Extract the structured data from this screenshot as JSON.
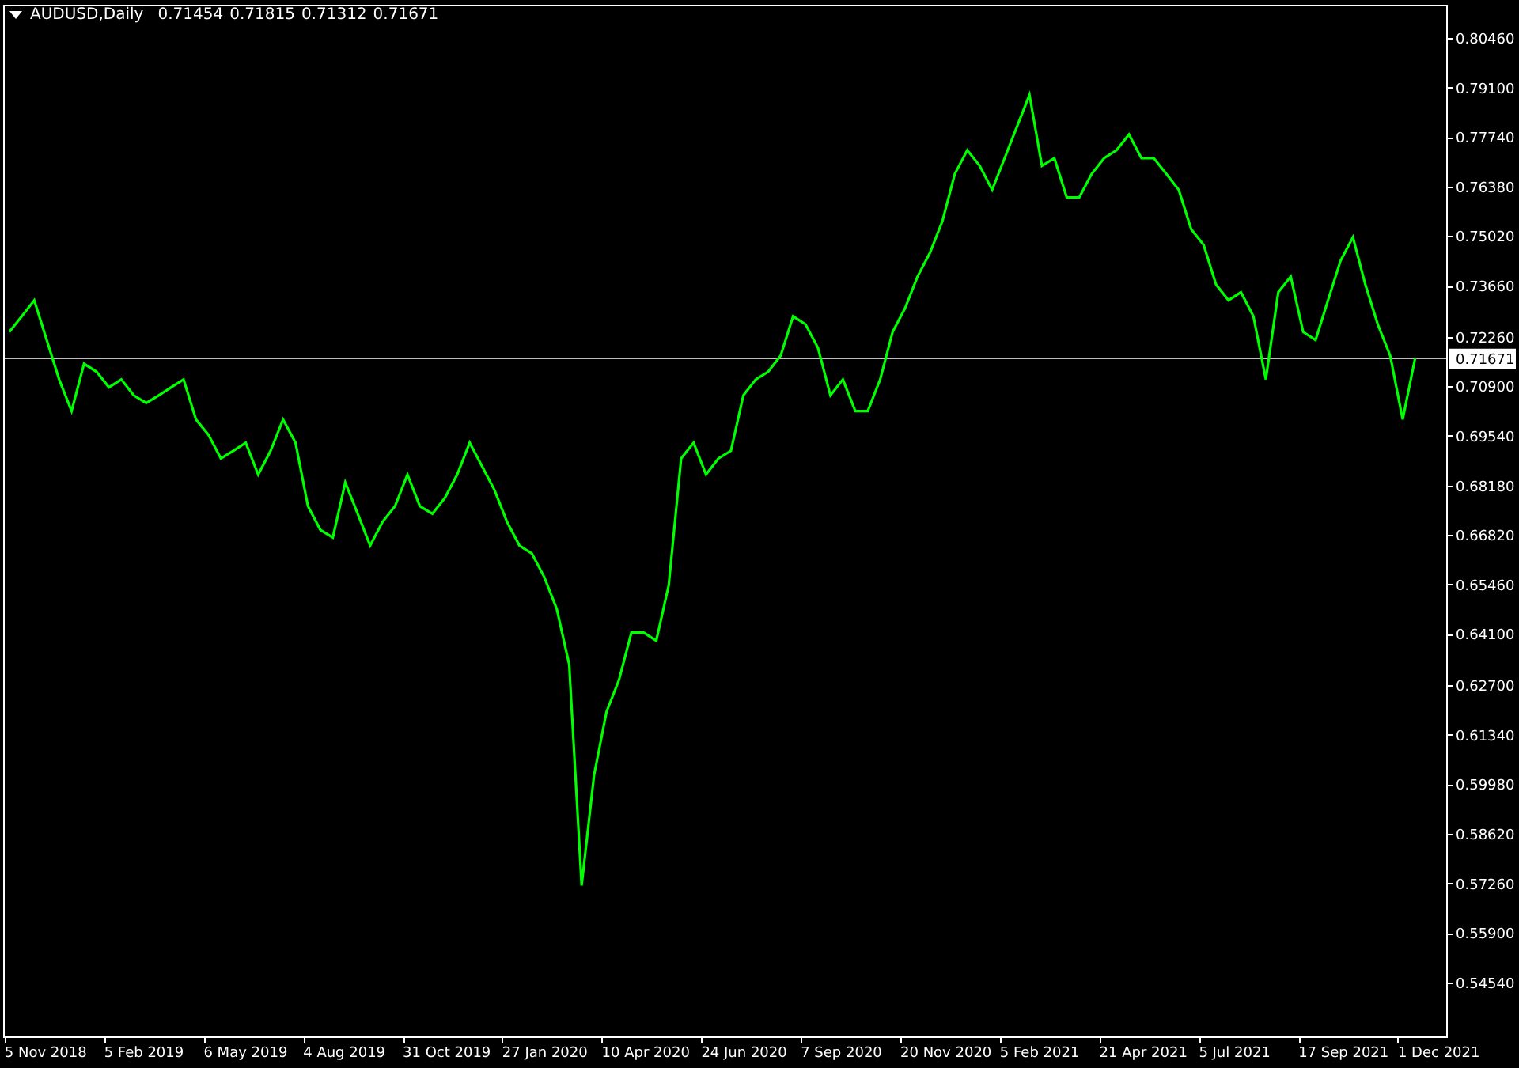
{
  "header": {
    "symbol": "AUDUSD,Daily",
    "ohlc": [
      "0.71454",
      "0.71815",
      "0.71312",
      "0.71671"
    ]
  },
  "chart_data": {
    "type": "line",
    "categories": [
      null,
      null,
      null,
      "5 Nov 2018",
      null,
      null,
      null,
      null,
      null,
      null,
      null,
      "5 Feb 2019",
      null,
      null,
      null,
      null,
      null,
      null,
      null,
      "6 May 2019",
      null,
      null,
      null,
      null,
      null,
      null,
      null,
      "4 Aug 2019",
      null,
      null,
      null,
      null,
      null,
      null,
      null,
      "31 Oct 2019",
      null,
      null,
      null,
      null,
      null,
      null,
      null,
      "27 Jan 2020",
      null,
      null,
      null,
      null,
      null,
      null,
      null,
      "10 Apr 2020",
      null,
      null,
      null,
      null,
      null,
      null,
      null,
      "24 Jun 2020",
      null,
      null,
      null,
      null,
      null,
      null,
      null,
      "7 Sep 2020",
      null,
      null,
      null,
      null,
      null,
      null,
      null,
      "20 Nov 2020",
      null,
      null,
      null,
      null,
      null,
      null,
      null,
      "5 Feb 2021",
      null,
      null,
      null,
      null,
      null,
      null,
      null,
      "21 Apr 2021",
      null,
      null,
      null,
      null,
      null,
      null,
      null,
      "5 Jul 2021",
      null,
      null,
      null,
      null,
      null,
      null,
      null,
      "17 Sep 2021",
      null,
      null,
      null,
      null,
      null,
      null,
      null,
      "1 Dec 2021"
    ],
    "series": [
      {
        "color": "#00ff00",
        "values": [
          0.7239,
          0.7282,
          0.7326,
          0.7217,
          0.7109,
          0.7022,
          0.7152,
          0.713,
          0.7087,
          0.7109,
          0.7065,
          0.7044,
          0.7065,
          0.7087,
          0.7109,
          0.6999,
          0.6957,
          0.6892,
          0.6913,
          0.6935,
          0.6848,
          0.6913,
          0.6999,
          0.6935,
          0.6761,
          0.6696,
          0.6675,
          0.6826,
          0.674,
          0.6653,
          0.6718,
          0.6761,
          0.6848,
          0.6761,
          0.674,
          0.6783,
          0.6848,
          0.6935,
          0.687,
          0.6805,
          0.6718,
          0.6653,
          0.6631,
          0.6566,
          0.6479,
          0.6327,
          0.572,
          0.6023,
          0.6197,
          0.6284,
          0.6414,
          0.6414,
          0.6392,
          0.6544,
          0.6892,
          0.6935,
          0.6848,
          0.6892,
          0.6913,
          0.7065,
          0.7109,
          0.713,
          0.7174,
          0.7282,
          0.726,
          0.7195,
          0.7065,
          0.7109,
          0.7022,
          0.7022,
          0.7109,
          0.7239,
          0.7304,
          0.7391,
          0.7456,
          0.7543,
          0.7673,
          0.7738,
          0.7695,
          0.7629,
          0.7716,
          0.7803,
          0.789,
          0.7695,
          0.7716,
          0.7608,
          0.7608,
          0.7673,
          0.7716,
          0.7738,
          0.7781,
          0.7716,
          0.7716,
          0.7673,
          0.7629,
          0.7521,
          0.7478,
          0.7369,
          0.7326,
          0.7348,
          0.7282,
          0.7109,
          0.7348,
          0.7391,
          0.7239,
          0.7217,
          0.7326,
          0.7434,
          0.7499,
          0.7369,
          0.726,
          0.7174,
          0.6999,
          0.7167,
          null,
          null
        ]
      }
    ],
    "ylim": [
      0.5306,
      0.8137
    ],
    "ref_lines": [
      {
        "axis": "y",
        "value": 0.71671,
        "label": "0.71671",
        "color": "#c0c0c0"
      }
    ],
    "yticks": [
      {
        "value": 0.8046,
        "label": "0.80460"
      },
      {
        "value": 0.791,
        "label": "0.79100"
      },
      {
        "value": 0.7774,
        "label": "0.77740"
      },
      {
        "value": 0.7638,
        "label": "0.76380"
      },
      {
        "value": 0.7502,
        "label": "0.75020"
      },
      {
        "value": 0.7366,
        "label": "0.73660"
      },
      {
        "value": 0.7226,
        "label": "0.72260"
      },
      {
        "value": 0.709,
        "label": "0.70900"
      },
      {
        "value": 0.6954,
        "label": "0.69540"
      },
      {
        "value": 0.6818,
        "label": "0.68180"
      },
      {
        "value": 0.6682,
        "label": "0.66820"
      },
      {
        "value": 0.6546,
        "label": "0.65460"
      },
      {
        "value": 0.641,
        "label": "0.64100"
      },
      {
        "value": 0.627,
        "label": "0.62700"
      },
      {
        "value": 0.6134,
        "label": "0.61340"
      },
      {
        "value": 0.5998,
        "label": "0.59980"
      },
      {
        "value": 0.5862,
        "label": "0.58620"
      },
      {
        "value": 0.5726,
        "label": "0.57260"
      },
      {
        "value": 0.559,
        "label": "0.55900"
      },
      {
        "value": 0.5454,
        "label": "0.54540"
      }
    ]
  }
}
